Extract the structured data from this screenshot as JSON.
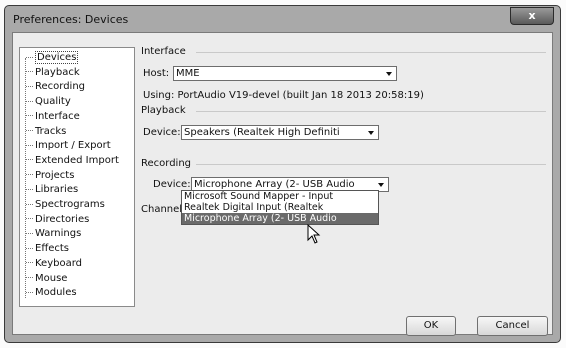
{
  "window": {
    "title": "Preferences: Devices",
    "close_glyph": "x"
  },
  "sidebar": {
    "items": [
      {
        "label": "Devices",
        "selected": true
      },
      {
        "label": "Playback"
      },
      {
        "label": "Recording"
      },
      {
        "label": "Quality"
      },
      {
        "label": "Interface"
      },
      {
        "label": "Tracks"
      },
      {
        "label": "Import / Export"
      },
      {
        "label": "Extended Import"
      },
      {
        "label": "Projects"
      },
      {
        "label": "Libraries"
      },
      {
        "label": "Spectrograms"
      },
      {
        "label": "Directories"
      },
      {
        "label": "Warnings"
      },
      {
        "label": "Effects"
      },
      {
        "label": "Keyboard"
      },
      {
        "label": "Mouse"
      },
      {
        "label": "Modules"
      }
    ]
  },
  "interface": {
    "section_label": "Interface",
    "host_label": "Host:",
    "host_value": "MME",
    "using_text": "Using: PortAudio V19-devel (built Jan 18 2013 20:58:19)"
  },
  "playback": {
    "section_label": "Playback",
    "device_label": "Device:",
    "device_value": "Speakers (Realtek High Definiti"
  },
  "recording": {
    "section_label": "Recording",
    "device_label": "Device:",
    "device_value": "Microphone Array (2- USB Audio",
    "channels_label": "Channels:",
    "options": [
      "Microsoft Sound Mapper - Input",
      "Realtek Digital Input (Realtek",
      "Microphone Array (2- USB Audio"
    ],
    "highlighted_index": 2
  },
  "buttons": {
    "ok": "OK",
    "cancel": "Cancel"
  }
}
